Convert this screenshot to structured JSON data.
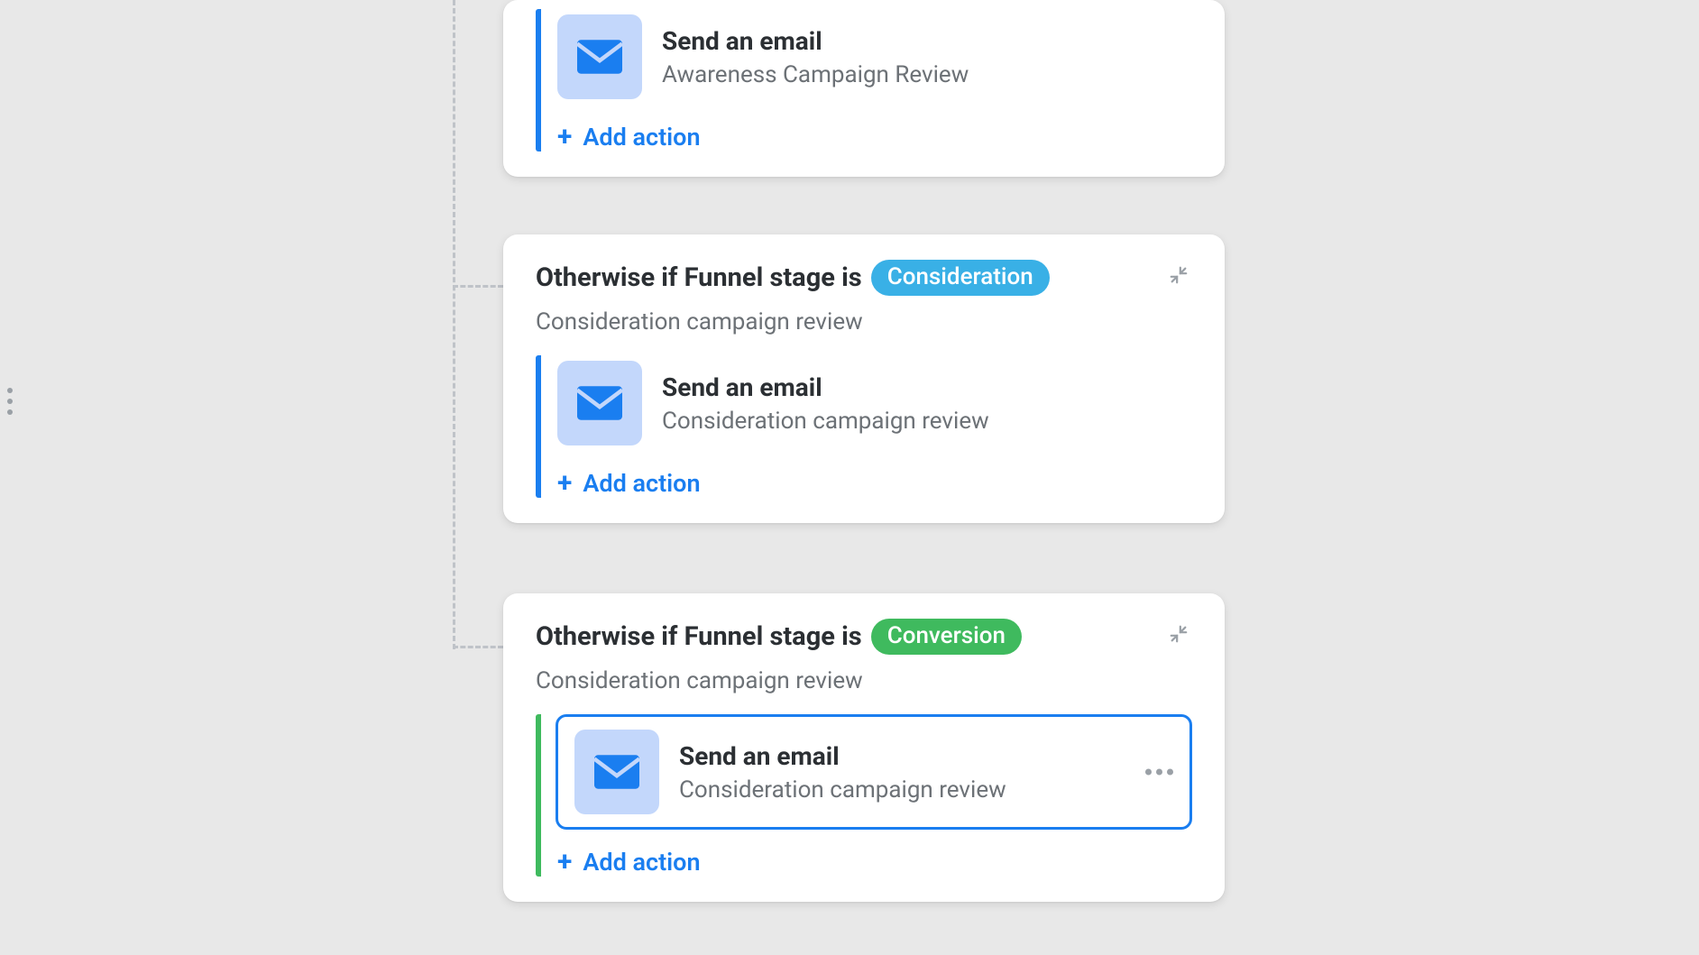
{
  "labels": {
    "add_action": "Add action",
    "condition_prefix": "Otherwise if Funnel stage is"
  },
  "cards": [
    {
      "condition_prefix": "",
      "tag": "",
      "tag_color": "",
      "subtitle": "",
      "accent": "blue",
      "action": {
        "title": "Send an email",
        "sub": "Awareness Campaign Review",
        "selected": false,
        "show_more": false
      },
      "show_header": false
    },
    {
      "condition_prefix": "Otherwise if Funnel stage is",
      "tag": "Consideration",
      "tag_color": "blue",
      "subtitle": "Consideration campaign review",
      "accent": "blue",
      "action": {
        "title": "Send an email",
        "sub": "Consideration campaign review",
        "selected": false,
        "show_more": false
      },
      "show_header": true
    },
    {
      "condition_prefix": "Otherwise if Funnel stage is",
      "tag": "Conversion",
      "tag_color": "green",
      "subtitle": "Consideration campaign review",
      "accent": "green",
      "action": {
        "title": "Send an email",
        "sub": "Consideration campaign review",
        "selected": true,
        "show_more": true
      },
      "show_header": true
    }
  ]
}
